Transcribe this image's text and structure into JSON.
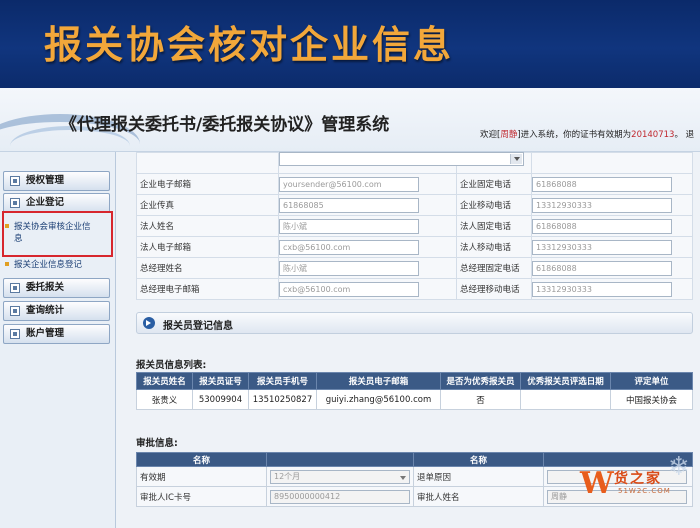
{
  "slide": {
    "title": "报关协会核对企业信息"
  },
  "header": {
    "system_title": "《代理报关委托书/委托报关协议》管理系统",
    "welcome_prefix": "欢迎[",
    "user": "周静",
    "welcome_mid": "]进入系统，你的证书有效期为",
    "cert_date": "20140713",
    "welcome_suffix": "。 退"
  },
  "sidebar": {
    "items": [
      {
        "label": "授权管理"
      },
      {
        "label": "企业登记"
      },
      {
        "label": "委托报关"
      },
      {
        "label": "查询统计"
      },
      {
        "label": "账户管理"
      }
    ],
    "sub_items": [
      {
        "label_line1": "报关协会审核企业信",
        "label_line2": "息"
      },
      {
        "label_line1": "报关企业信息登记"
      }
    ]
  },
  "company_form": {
    "rows": [
      {
        "left_label": "企业电子邮箱",
        "left_value": "yoursender@56100.com",
        "right_label": "企业固定电话",
        "right_value": "61868088"
      },
      {
        "left_label": "企业传真",
        "left_value": "61868085",
        "right_label": "企业移动电话",
        "right_value": "13312930333"
      },
      {
        "left_label": "法人姓名",
        "left_value": "陈小斌",
        "right_label": "法人固定电话",
        "right_value": "61868088"
      },
      {
        "left_label": "法人电子邮箱",
        "left_value": "cxb@56100.com",
        "right_label": "法人移动电话",
        "right_value": "13312930333"
      },
      {
        "left_label": "总经理姓名",
        "left_value": "陈小斌",
        "right_label": "总经理固定电话",
        "right_value": "61868088"
      },
      {
        "left_label": "总经理电子邮箱",
        "left_value": "cxb@56100.com",
        "right_label": "总经理移动电话",
        "right_value": "13312930333"
      }
    ]
  },
  "declarant_section": {
    "title": "报关员登记信息"
  },
  "declarant_list": {
    "heading": "报关员信息列表:",
    "columns": [
      "报关员姓名",
      "报关员证号",
      "报关员手机号",
      "报关员电子邮箱",
      "是否为优秀报关员",
      "优秀报关员评选日期",
      "评定单位"
    ],
    "rows": [
      [
        "张贵义",
        "53009904",
        "13510250827",
        "guiyi.zhang@56100.com",
        "否",
        "",
        "中国报关协会"
      ]
    ]
  },
  "approval": {
    "heading": "审批信息:",
    "col_left": "名称",
    "col_right": "名称",
    "rows": [
      {
        "left_label": "有效期",
        "left_value": "12个月",
        "right_label": "退单原因",
        "right_value": ""
      },
      {
        "left_label": "审批人IC卡号",
        "left_value": "8950000000412",
        "right_label": "审批人姓名",
        "right_value": "周静"
      }
    ]
  },
  "watermark": {
    "text": "货之家",
    "url": "51W2C.COM",
    "glyph": "W"
  },
  "colors": {
    "title_orange": "#f2a73a",
    "header_navy": "#10357e",
    "table_header": "#3b5a86",
    "highlight_red": "#d7262d"
  }
}
